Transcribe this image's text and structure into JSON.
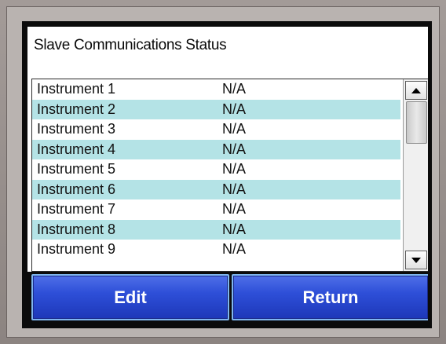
{
  "screen": {
    "title": "Slave Communications Status"
  },
  "instruments": [
    {
      "name": "Instrument 1",
      "status": "N/A"
    },
    {
      "name": "Instrument 2",
      "status": "N/A"
    },
    {
      "name": "Instrument 3",
      "status": "N/A"
    },
    {
      "name": "Instrument 4",
      "status": "N/A"
    },
    {
      "name": "Instrument 5",
      "status": "N/A"
    },
    {
      "name": "Instrument 6",
      "status": "N/A"
    },
    {
      "name": "Instrument 7",
      "status": "N/A"
    },
    {
      "name": "Instrument 8",
      "status": "N/A"
    },
    {
      "name": "Instrument 9",
      "status": "N/A"
    }
  ],
  "buttons": {
    "edit_label": "Edit",
    "return_label": "Return"
  },
  "colors": {
    "row_alt": "#b4e3e6",
    "button_blue": "#2e4fd8",
    "button_border": "#7fb6f0"
  },
  "icons": {
    "scroll_up": "scroll-up-arrow-icon",
    "scroll_down": "scroll-down-arrow-icon"
  }
}
